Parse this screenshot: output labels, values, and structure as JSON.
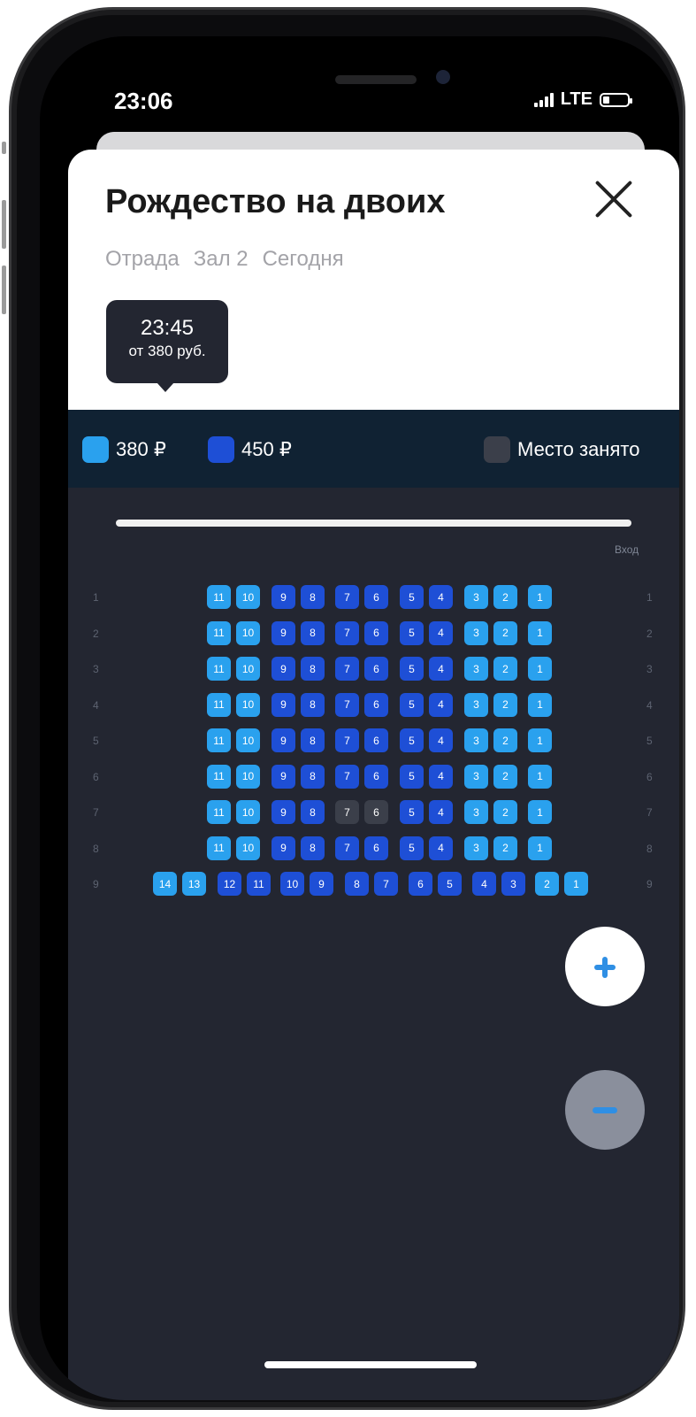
{
  "status_bar": {
    "time": "23:06",
    "network": "LTE"
  },
  "header": {
    "title": "Рождество на двоих",
    "cinema": "Отрада",
    "hall": "Зал 2",
    "day": "Сегодня"
  },
  "session": {
    "time": "23:45",
    "price_from": "от 380 руб."
  },
  "legend": {
    "price_low": "380 ₽",
    "price_high": "450 ₽",
    "taken": "Место занято"
  },
  "hall_map": {
    "entry_label": "Вход"
  },
  "colors": {
    "price_low": "#2aa1ee",
    "price_high": "#1e4fd6",
    "taken": "#3b3f4a",
    "legend_bg": "#102233",
    "hall_bg": "#232631"
  },
  "seat_rows": [
    {
      "row": "1",
      "seats": [
        "11",
        "10",
        "9",
        "8",
        "7",
        "6",
        "5",
        "4",
        "3",
        "2",
        "1"
      ]
    },
    {
      "row": "2",
      "seats": [
        "11",
        "10",
        "9",
        "8",
        "7",
        "6",
        "5",
        "4",
        "3",
        "2",
        "1"
      ]
    },
    {
      "row": "3",
      "seats": [
        "11",
        "10",
        "9",
        "8",
        "7",
        "6",
        "5",
        "4",
        "3",
        "2",
        "1"
      ]
    },
    {
      "row": "4",
      "seats": [
        "11",
        "10",
        "9",
        "8",
        "7",
        "6",
        "5",
        "4",
        "3",
        "2",
        "1"
      ]
    },
    {
      "row": "5",
      "seats": [
        "11",
        "10",
        "9",
        "8",
        "7",
        "6",
        "5",
        "4",
        "3",
        "2",
        "1"
      ]
    },
    {
      "row": "6",
      "seats": [
        "11",
        "10",
        "9",
        "8",
        "7",
        "6",
        "5",
        "4",
        "3",
        "2",
        "1"
      ]
    },
    {
      "row": "7",
      "seats": [
        "11",
        "10",
        "9",
        "8",
        "7",
        "6",
        "5",
        "4",
        "3",
        "2",
        "1"
      ],
      "taken": [
        "7",
        "6"
      ]
    },
    {
      "row": "8",
      "seats": [
        "11",
        "10",
        "9",
        "8",
        "7",
        "6",
        "5",
        "4",
        "3",
        "2",
        "1"
      ]
    },
    {
      "row": "9",
      "seats": [
        "14",
        "13",
        "12",
        "11",
        "10",
        "9",
        "8",
        "7",
        "6",
        "5",
        "4",
        "3",
        "2",
        "1"
      ]
    }
  ]
}
